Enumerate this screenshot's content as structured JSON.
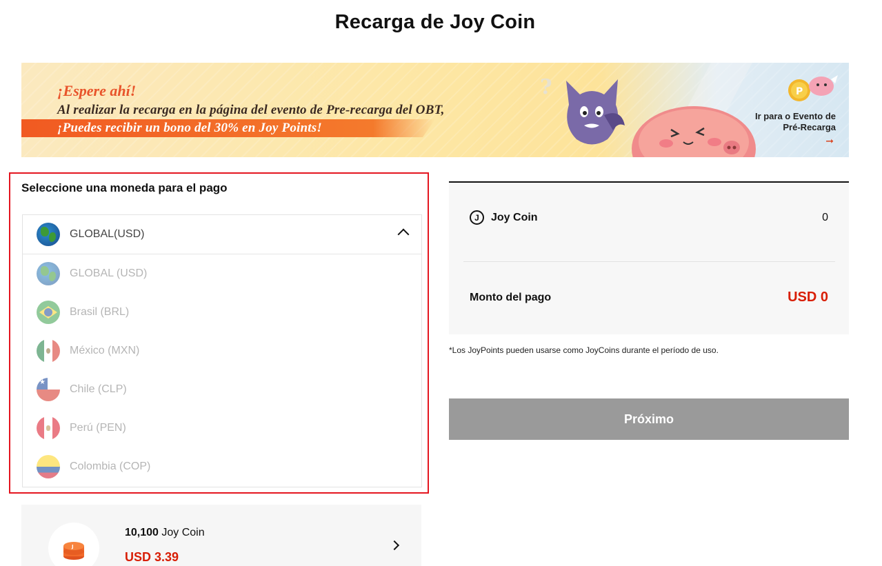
{
  "page": {
    "title": "Recarga de Joy Coin"
  },
  "banner": {
    "headline": "¡Espere ahí!",
    "line1": "Al realizar la recarga en la página del evento de Pre-recarga del OBT,",
    "line2": "¡Puedes recibir un bono del 30% en Joy Points!",
    "link_line1": "Ir para o Evento de",
    "link_line2": "Pré-Recarga",
    "link_arrow": "➞"
  },
  "currency": {
    "label": "Seleccione una moneda para el pago",
    "selected": {
      "label": "GLOBAL(USD)",
      "flag": "globe-icon"
    },
    "options": [
      {
        "label": "GLOBAL (USD)",
        "flag": "globe-icon"
      },
      {
        "label": "Brasil (BRL)",
        "flag": "brazil-flag-icon"
      },
      {
        "label": "México (MXN)",
        "flag": "mexico-flag-icon"
      },
      {
        "label": "Chile (CLP)",
        "flag": "chile-flag-icon"
      },
      {
        "label": "Perú (PEN)",
        "flag": "peru-flag-icon"
      },
      {
        "label": "Colombia (COP)",
        "flag": "colombia-flag-icon"
      }
    ]
  },
  "package": {
    "amount": "10,100",
    "unit": " Joy Coin",
    "price": "USD 3.39"
  },
  "summary": {
    "coin_icon": "J",
    "coin_label": "Joy Coin",
    "coin_value": "0",
    "payment_label": "Monto del pago",
    "payment_value": "USD 0"
  },
  "footnote": "*Los JoyPoints pueden usarse como JoyCoins durante el período de uso.",
  "next_button": "Próximo",
  "colors": {
    "accent_red": "#d81e06",
    "highlight_border": "#e4151f",
    "button_disabled": "#9a9a9a"
  }
}
